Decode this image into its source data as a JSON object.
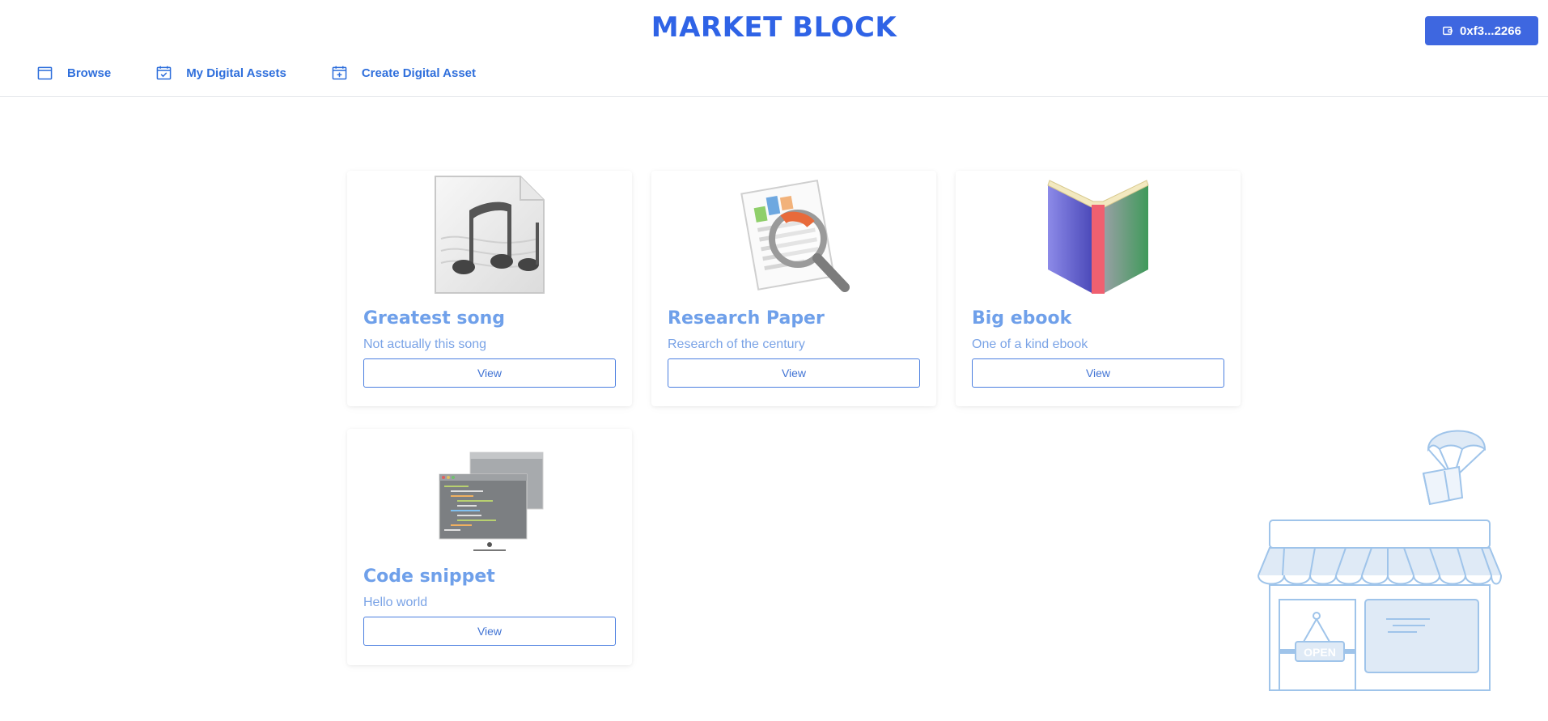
{
  "header": {
    "brand": "MARKET BLOCK",
    "wallet_label": "0xf3...2266",
    "wallet_icon": "wallet-icon"
  },
  "nav": {
    "items": [
      {
        "label": "Browse",
        "icon": "browser-window-icon"
      },
      {
        "label": "My Digital Assets",
        "icon": "calendar-check-icon"
      },
      {
        "label": "Create Digital Asset",
        "icon": "calendar-plus-icon"
      }
    ]
  },
  "assets": [
    {
      "title": "Greatest song",
      "description": "Not actually this song",
      "button": "View",
      "image": "music-file-icon"
    },
    {
      "title": "Research Paper",
      "description": "Research of the century",
      "button": "View",
      "image": "research-document-icon"
    },
    {
      "title": "Big ebook",
      "description": "One of a kind ebook",
      "button": "View",
      "image": "open-book-icon"
    },
    {
      "title": "Code snippet",
      "description": "Hello world",
      "button": "View",
      "image": "code-windows-icon"
    }
  ],
  "illustration": {
    "sign_text": "OPEN",
    "icon": "storefront-illustration"
  },
  "colors": {
    "brand": "#2f63e6",
    "accent": "#3e67e0",
    "link": "#2f6fdc",
    "card_title": "#6fa0ea"
  }
}
